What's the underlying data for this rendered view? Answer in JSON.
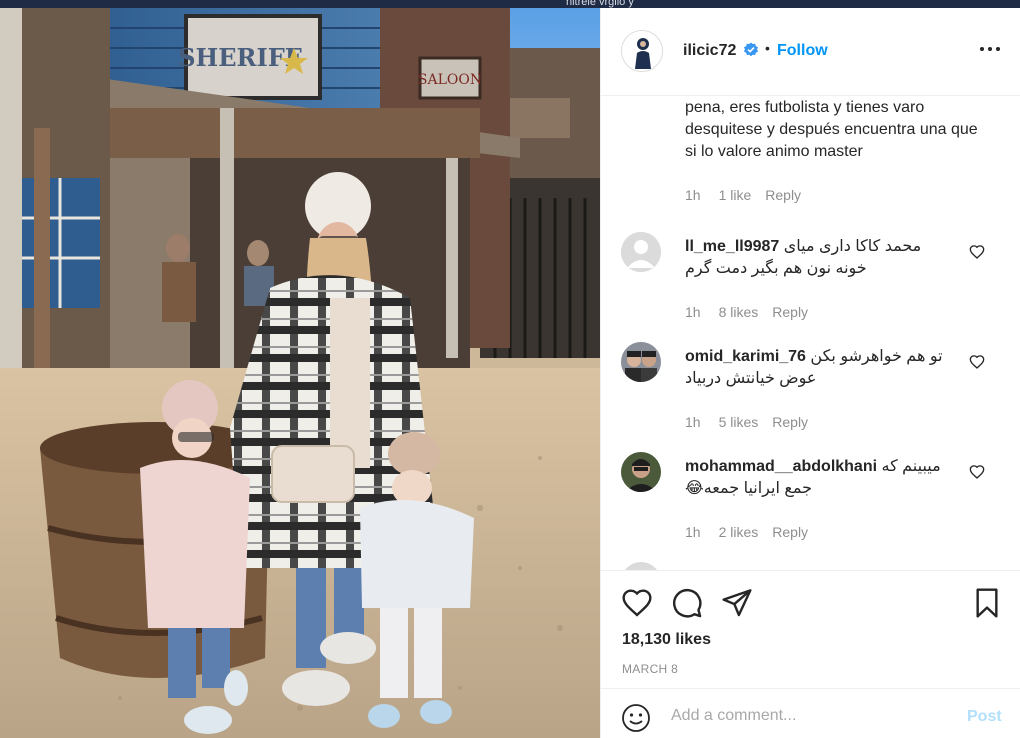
{
  "backdrop": {
    "partial_text": "hitrele vrgilo y"
  },
  "photo": {
    "description_sign_left": "SHERIFF",
    "description_sign_right": "SALOON"
  },
  "header": {
    "username": "ilicic72",
    "separator": "•",
    "follow_label": "Follow"
  },
  "first_comment": {
    "text": "pena, eres futbolista y tienes varo desquitese y después encuentra una que si lo valore animo master",
    "time": "1h",
    "likes": "1 like",
    "reply": "Reply"
  },
  "comments": [
    {
      "username": "ll_me_ll9987",
      "text": "محمد کاکا داری میای خونه نون هم بگیر دمت گرم",
      "time": "1h",
      "likes": "8 likes",
      "reply": "Reply"
    },
    {
      "username": "omid_karimi_76",
      "text": "تو هم خواهرشو بکن عوض خیانتش دربیاد",
      "time": "1h",
      "likes": "5 likes",
      "reply": "Reply"
    },
    {
      "username": "mohammad__abdolkhani",
      "text": "میبینم که جمع ایرانیا جمعه😂",
      "time": "1h",
      "likes": "2 likes",
      "reply": "Reply"
    }
  ],
  "actions": {
    "likes_count": "18,130 likes",
    "date": "MARCH 8"
  },
  "add_comment": {
    "placeholder": "Add a comment...",
    "post_label": "Post"
  },
  "icons": {
    "verified": "verified-badge-icon",
    "more": "more-options-icon",
    "heart": "heart-icon",
    "comment": "comment-icon",
    "share": "share-icon",
    "save": "bookmark-icon",
    "emoji": "emoji-icon"
  },
  "colors": {
    "accent": "#0095f6",
    "post_disabled": "#b2dffc",
    "muted": "#8e8e8e"
  }
}
